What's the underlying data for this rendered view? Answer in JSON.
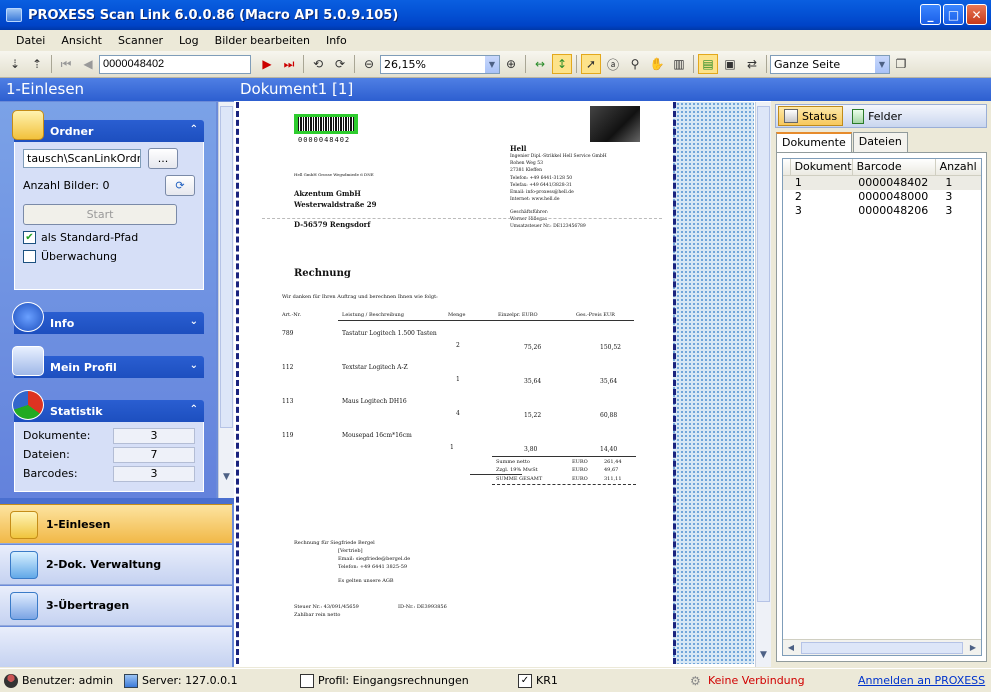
{
  "window": {
    "title": "PROXESS Scan Link 6.0.0.86 (Macro API 5.0.9.105)"
  },
  "menu": [
    "Datei",
    "Ansicht",
    "Scanner",
    "Log",
    "Bilder bearbeiten",
    "Info"
  ],
  "toolbar": {
    "doc_number": "0000048402",
    "zoom": "26,15%",
    "fit_mode": "Ganze Seite"
  },
  "left": {
    "header": "1-Einlesen",
    "ordner": {
      "title": "Ordner",
      "path": "tausch\\ScanLinkOrdner",
      "browse": "...",
      "count_label": "Anzahl Bilder: 0",
      "start": "Start",
      "std_path": "als Standard-Pfad",
      "watch": "Überwachung"
    },
    "info": {
      "title": "Info"
    },
    "profil": {
      "title": "Mein Profil"
    },
    "statistik": {
      "title": "Statistik",
      "rows": [
        {
          "label": "Dokumente:",
          "value": "3"
        },
        {
          "label": "Dateien:",
          "value": "7"
        },
        {
          "label": "Barcodes:",
          "value": "3"
        }
      ]
    },
    "nav": [
      "1-Einlesen",
      "2-Dok. Verwaltung",
      "3-Übertragen"
    ]
  },
  "doc": {
    "header": "Dokument1 [1]",
    "barcode": "0000048402",
    "sender": "Hell GmbH Grosse Wegsdmiede 6 DNE",
    "recipient": [
      "Akzentum GmbH",
      "Westerwaldstraße 29",
      "D-56579 Rengsdorf"
    ],
    "company": [
      "Hell",
      "Ingenier Dipl.-Strikkel Hell Service GmbH",
      "Rohen Weg 53",
      "27381 Kleffen",
      "Telefon: +49 6441-3128 50",
      "Telefax: +49 6441/3828-31",
      "Email: info-proxess@hell.de",
      "Internet: www.hell.de"
    ],
    "director": [
      "Geschäftsführer:",
      "Werner Hillegas",
      "Umsatzsteuer Nr.: DE123456789"
    ],
    "heading": "Rechnung",
    "intro": "Wir danken für Ihren Auftrag und berechnen Ihnen wie folgt:",
    "cols": [
      "Art.-Nr.",
      "Leistung / Beschreibung",
      "Menge",
      "Einzelpr. EURO",
      "Ges.-Preis EUR"
    ],
    "items": [
      {
        "art": "789",
        "desc": "Tastatur Logitech 1.500 Tasten",
        "qty": "2",
        "unit": "75,26",
        "total": "150,52"
      },
      {
        "art": "112",
        "desc": "Textstar Logitech A-Z",
        "qty": "1",
        "unit": "35,64",
        "total": "35,64"
      },
      {
        "art": "113",
        "desc": "Maus Logitech DH16",
        "qty": "4",
        "unit": "15,22",
        "total": "60,88"
      },
      {
        "art": "119",
        "desc": "Mousepad 16cm*16cm",
        "qty": "1",
        "unit": "3,80",
        "total": "14,40"
      }
    ],
    "sums": [
      {
        "label": "Summe netto",
        "cur": "EURO",
        "value": "261,44"
      },
      {
        "label": "Zzgl. 19% MwSt",
        "cur": "EURO",
        "value": "49,67"
      },
      {
        "label": "SUMME GESAMT",
        "cur": "EURO",
        "value": "311,11"
      }
    ],
    "footer": [
      "Rechnung für Siegfriede Bergel",
      "[Vertrieb]",
      "Email: siegfriede@bergel.de",
      "Telefon: +49 6441 3825-59",
      "Es gelten unsere AGB"
    ],
    "tax": "Steuer Nr.: 43/091/45659",
    "iban": "ID-Nr.: DE3993856",
    "pay": "Zahlbar rein netto"
  },
  "right": {
    "tabs": [
      "Status",
      "Felder"
    ],
    "subtabs": [
      "Dokumente",
      "Dateien"
    ],
    "columns": [
      "Dokument",
      "Barcode",
      "Anzahl"
    ],
    "rows": [
      [
        "1",
        "0000048402",
        "1"
      ],
      [
        "2",
        "0000048000",
        "3"
      ],
      [
        "3",
        "0000048206",
        "3"
      ]
    ]
  },
  "status": {
    "user": "Benutzer: admin",
    "server": "Server: 127.0.0.1",
    "profile": "Profil: Eingangsrechnungen",
    "kr": "KR1",
    "conn": "Keine Verbindung",
    "login": "Anmelden an PROXESS"
  },
  "colors": {
    "title_blue": "#0453D6",
    "panel_blue": "#6B8BD9",
    "nav_active": "#F5C464",
    "conn_red": "#D00000",
    "login_blue": "#0033CC"
  }
}
